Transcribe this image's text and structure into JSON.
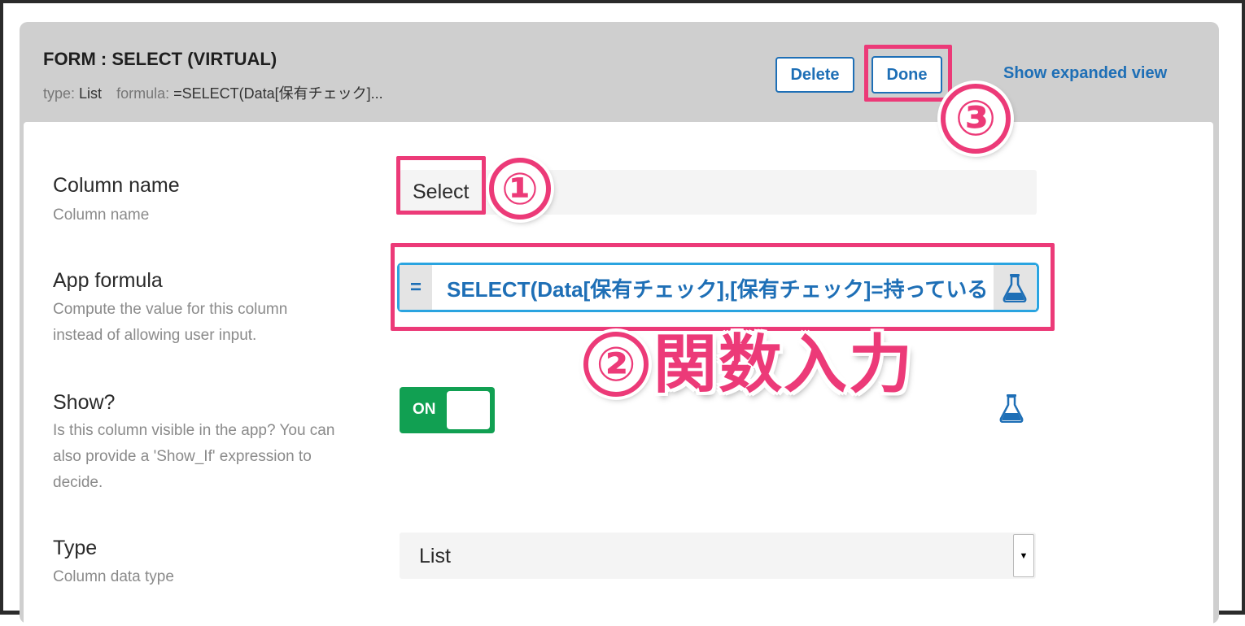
{
  "header": {
    "title": "FORM : SELECT (VIRTUAL)",
    "type_label": "type:",
    "type_value": "List",
    "formula_label": "formula:",
    "formula_value": "=SELECT(Data[保有チェック]..."
  },
  "buttons": {
    "delete": "Delete",
    "done": "Done",
    "expanded": "Show expanded view"
  },
  "fields": {
    "column_name": {
      "label": "Column name",
      "desc": "Column name",
      "value": "Select"
    },
    "app_formula": {
      "label": "App formula",
      "desc1": "Compute the value for this column",
      "desc2": "instead of allowing user input.",
      "eq": "=",
      "value": "SELECT(Data[保有チェック],[保有チェック]=持っている"
    },
    "show": {
      "label": "Show?",
      "desc1": "Is this column visible in the app? You can",
      "desc2": "also provide a 'Show_If' expression to",
      "desc3": "decide.",
      "toggle": "ON"
    },
    "type": {
      "label": "Type",
      "desc": "Column data type",
      "value": "List"
    }
  },
  "annotations": {
    "step1": "①",
    "step2": "②",
    "step2_text": "関数入力",
    "step3": "③"
  },
  "colors": {
    "accent_blue": "#1e6fb6",
    "highlight_pink": "#ec3a78",
    "toggle_green": "#11a052",
    "header_gray": "#cfcfcf"
  }
}
